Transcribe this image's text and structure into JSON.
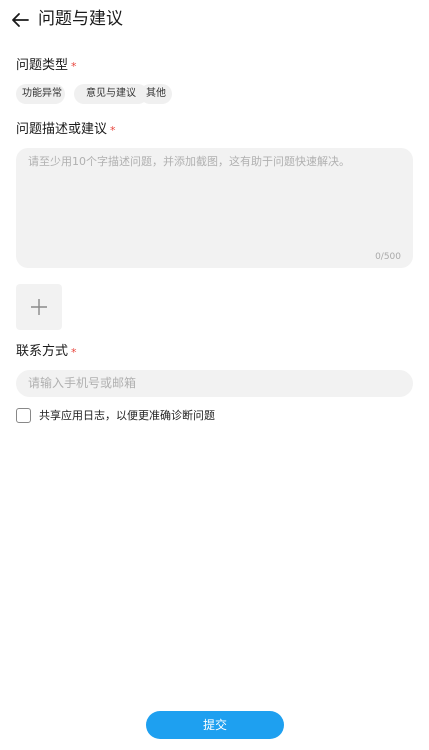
{
  "header": {
    "title": "问题与建议",
    "back_icon": "arrow-left-icon"
  },
  "issue_type": {
    "label": "问题类型",
    "required_mark": "*",
    "options": [
      "功能异常",
      "意见与建议",
      "其他"
    ]
  },
  "description": {
    "label": "问题描述或建议",
    "required_mark": "*",
    "placeholder": "请至少用10个字描述问题，并添加截图，这有助于问题快速解决。",
    "counter": "0/500"
  },
  "attachment": {
    "add_icon": "plus-icon"
  },
  "contact": {
    "label": "联系方式",
    "required_mark": "*",
    "placeholder": "请输入手机号或邮箱"
  },
  "share_logs": {
    "label": "共享应用日志，以便更准确诊断问题",
    "checked": false
  },
  "submit": {
    "label": "提交"
  },
  "colors": {
    "accent": "#1ea0f0",
    "required": "#e8453c",
    "field_bg": "#f2f2f2"
  }
}
